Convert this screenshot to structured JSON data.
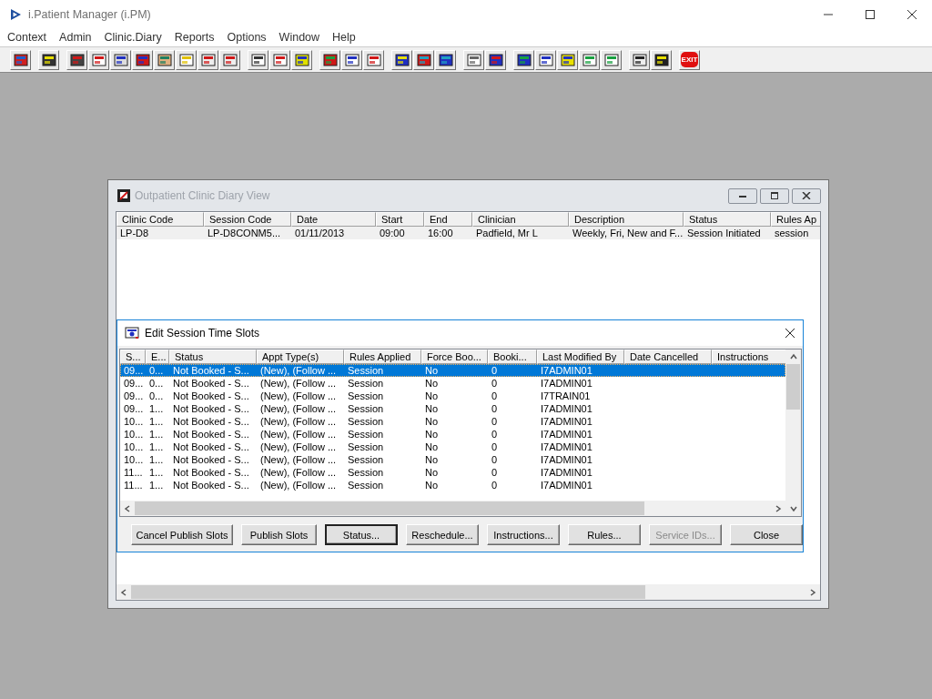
{
  "app": {
    "title": "i.Patient Manager (i.PM)",
    "menu": [
      "Context",
      "Admin",
      "Clinic.Diary",
      "Reports",
      "Options",
      "Window",
      "Help"
    ],
    "exit_label": "EXIT"
  },
  "diary_window": {
    "title": "Outpatient Clinic Diary View",
    "columns": [
      "Clinic Code",
      "Session Code",
      "Date",
      "Start",
      "End",
      "Clinician",
      "Description",
      "Status",
      "Rules Ap"
    ],
    "rows": [
      {
        "selected": false,
        "cells": [
          "LP-D8",
          "LP-D8CONM5...",
          "01/11/2013",
          "09:00",
          "16:00",
          "Padfield, Mr L",
          "Weekly, Fri, New and F...",
          "Session Initiated",
          "session"
        ]
      }
    ]
  },
  "slots_dialog": {
    "title": "Edit Session Time Slots",
    "columns": [
      "S...",
      "E...",
      "Status",
      "Appt Type(s)",
      "Rules Applied",
      "Force Boo...",
      "Booki...",
      "Last Modified By",
      "Date Cancelled",
      "Instructions"
    ],
    "rows": [
      {
        "selected": true,
        "cells": [
          "09...",
          "0...",
          "Not Booked - S...",
          "(New), (Follow ...",
          "Session",
          "No",
          "0",
          "I7ADMIN01"
        ]
      },
      {
        "selected": false,
        "cells": [
          "09...",
          "0...",
          "Not Booked - S...",
          "(New), (Follow ...",
          "Session",
          "No",
          "0",
          "I7ADMIN01"
        ]
      },
      {
        "selected": false,
        "cells": [
          "09...",
          "0...",
          "Not Booked - S...",
          "(New), (Follow ...",
          "Session",
          "No",
          "0",
          "I7TRAIN01"
        ]
      },
      {
        "selected": false,
        "cells": [
          "09...",
          "1...",
          "Not Booked - S...",
          "(New), (Follow ...",
          "Session",
          "No",
          "0",
          "I7ADMIN01"
        ]
      },
      {
        "selected": false,
        "cells": [
          "10...",
          "1...",
          "Not Booked - S...",
          "(New), (Follow ...",
          "Session",
          "No",
          "0",
          "I7ADMIN01"
        ]
      },
      {
        "selected": false,
        "cells": [
          "10...",
          "1...",
          "Not Booked - S...",
          "(New), (Follow ...",
          "Session",
          "No",
          "0",
          "I7ADMIN01"
        ]
      },
      {
        "selected": false,
        "cells": [
          "10...",
          "1...",
          "Not Booked - S...",
          "(New), (Follow ...",
          "Session",
          "No",
          "0",
          "I7ADMIN01"
        ]
      },
      {
        "selected": false,
        "cells": [
          "10...",
          "1...",
          "Not Booked - S...",
          "(New), (Follow ...",
          "Session",
          "No",
          "0",
          "I7ADMIN01"
        ]
      },
      {
        "selected": false,
        "cells": [
          "11...",
          "1...",
          "Not Booked - S...",
          "(New), (Follow ...",
          "Session",
          "No",
          "0",
          "I7ADMIN01"
        ]
      },
      {
        "selected": false,
        "cells": [
          "11...",
          "1...",
          "Not Booked - S...",
          "(New), (Follow ...",
          "Session",
          "No",
          "0",
          "I7ADMIN01"
        ]
      }
    ],
    "buttons": [
      {
        "label": "Cancel Publish Slots",
        "disabled": false,
        "default": false
      },
      {
        "label": "Publish Slots",
        "disabled": false,
        "default": false
      },
      {
        "label": "Status...",
        "disabled": false,
        "default": true
      },
      {
        "label": "Reschedule...",
        "disabled": false,
        "default": false
      },
      {
        "label": "Instructions...",
        "disabled": false,
        "default": false
      },
      {
        "label": "Rules...",
        "disabled": false,
        "default": false
      },
      {
        "label": "Service IDs...",
        "disabled": true,
        "default": false
      },
      {
        "label": "Close",
        "disabled": false,
        "default": false
      }
    ]
  }
}
